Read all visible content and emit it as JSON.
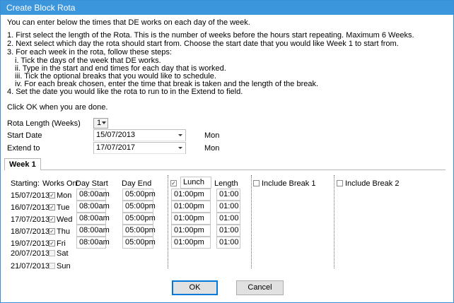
{
  "window": {
    "title": "Create Block Rota"
  },
  "instructions": [
    "You can enter below the times that DE works on each day of the week.",
    "1. First select the length of the Rota. This is the number of weeks before the hours start repeating. Maximum 6 Weeks.",
    "2. Next select which day the rota should start from. Choose the start date that you would like Week 1 to start from.",
    "3. For each week in the rota, follow these steps:",
    "i. Tick the days of the week that DE works.",
    "ii. Type in the start and end times for each day that is worked.",
    "iii. Tick the optional breaks that you would like to schedule.",
    "iv. For each break chosen, enter the time that break is taken and the length of the break.",
    "4. Set the date you would like the rota to run to in the Extend to field.",
    "Click OK when you are done."
  ],
  "form": {
    "rota_length_label": "Rota Length (Weeks)",
    "rota_length_value": "1",
    "start_date_label": "Start Date",
    "start_date_value": "15/07/2013",
    "start_day": "Mon",
    "extend_to_label": "Extend to",
    "extend_to_value": "17/07/2017",
    "extend_day": "Mon"
  },
  "tab": {
    "label": "Week 1"
  },
  "grid": {
    "headers": {
      "starting": "Starting:",
      "works_on": "Works On:",
      "day_start": "Day Start",
      "day_end": "Day End",
      "break1_name": "Lunch",
      "length": "Length",
      "include_break1": "Include Break 1",
      "include_break2": "Include Break 2"
    },
    "lunch_checked": true,
    "rows": [
      {
        "date": "15/07/2013",
        "day": "Mon",
        "checked": true,
        "start": "08:00am",
        "end": "05:00pm",
        "break_time": "01:00pm",
        "break_len": "01:00"
      },
      {
        "date": "16/07/2013",
        "day": "Tue",
        "checked": true,
        "start": "08:00am",
        "end": "05:00pm",
        "break_time": "01:00pm",
        "break_len": "01:00"
      },
      {
        "date": "17/07/2013",
        "day": "Wed",
        "checked": true,
        "start": "08:00am",
        "end": "05:00pm",
        "break_time": "01:00pm",
        "break_len": "01:00"
      },
      {
        "date": "18/07/2013",
        "day": "Thu",
        "checked": true,
        "start": "08:00am",
        "end": "05:00pm",
        "break_time": "01:00pm",
        "break_len": "01:00"
      },
      {
        "date": "19/07/2013",
        "day": "Fri",
        "checked": true,
        "start": "08:00am",
        "end": "05:00pm",
        "break_time": "01:00pm",
        "break_len": "01:00"
      },
      {
        "date": "20/07/2013",
        "day": "Sat",
        "checked": false
      },
      {
        "date": "21/07/2013",
        "day": "Sun",
        "checked": false
      }
    ]
  },
  "buttons": {
    "ok": "OK",
    "cancel": "Cancel"
  },
  "colors": {
    "titlebar": "#3c96dc",
    "default_button_border": "#0078d7"
  }
}
